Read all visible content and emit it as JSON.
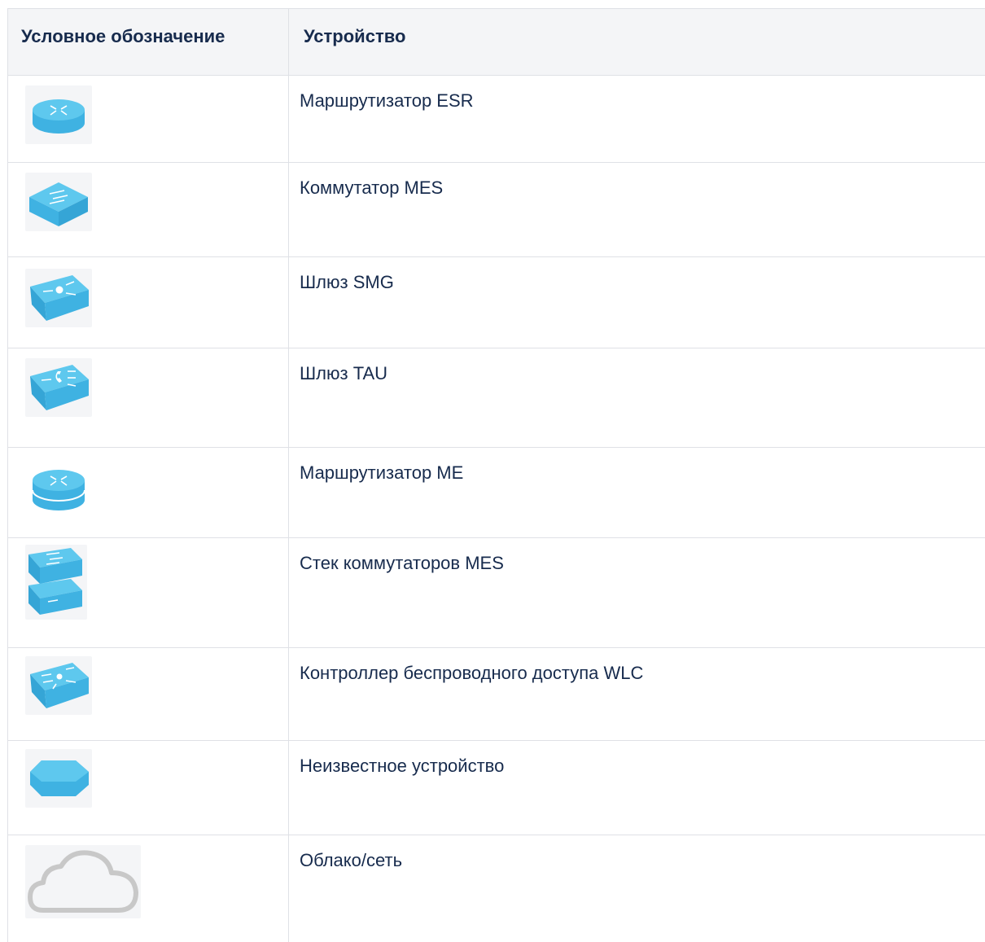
{
  "table": {
    "headers": {
      "symbol": "Условное обозначение",
      "device": "Устройство"
    },
    "rows": [
      {
        "icon": "router-icon",
        "device": "Маршрутизатор ESR"
      },
      {
        "icon": "switch-icon",
        "device": "Коммутатор MES"
      },
      {
        "icon": "gateway-smg-icon",
        "device": "Шлюз SMG"
      },
      {
        "icon": "gateway-tau-icon",
        "device": "Шлюз TAU"
      },
      {
        "icon": "router-me-icon",
        "device": "Маршрутизатор ME"
      },
      {
        "icon": "switch-stack-icon",
        "device": "Стек коммутаторов MES"
      },
      {
        "icon": "wlc-icon",
        "device": "Контроллер беспроводного доступа WLC"
      },
      {
        "icon": "unknown-device-icon",
        "device": "Неизвестное устройство"
      },
      {
        "icon": "cloud-icon",
        "device": "Облако/сеть"
      }
    ]
  },
  "colors": {
    "icon_top": "#5ec8ee",
    "icon_side": "#3fb2e2",
    "border": "#dfe1e6",
    "header_bg": "#f4f5f7",
    "text": "#172b4d",
    "cloud": "#c8c8c8"
  }
}
